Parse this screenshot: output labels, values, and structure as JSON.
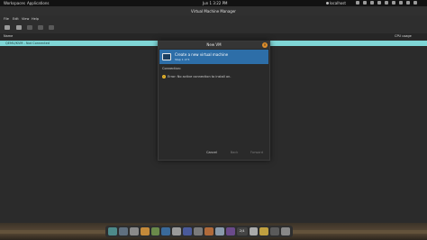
{
  "topbar": {
    "workspaces_label": "Workspaces",
    "applications_label": "Applications",
    "clock": "Jun 1   3:22 PM",
    "hostname": "localhost"
  },
  "window": {
    "title": "Virtual Machine Manager",
    "menu": [
      "File",
      "Edit",
      "View",
      "Help"
    ],
    "column_name": "Name",
    "column_cpu": "CPU usage",
    "connection_row": "QEMU/KVM - Not Connected"
  },
  "dialog": {
    "title": "New VM",
    "close_glyph": "×",
    "banner_title": "Create a new virtual machine",
    "banner_step": "Step 1 of 5",
    "section_label": "Connection:",
    "warn_glyph": "!",
    "error_text": "Error: No active connection to install on.",
    "cancel_label": "Cancel",
    "back_label": "Back",
    "forward_label": "Forward"
  },
  "dock": {
    "workspace_badge": "2/4",
    "apps": [
      {
        "name": "dock-app-1",
        "color": "#4d8a8a"
      },
      {
        "name": "dock-app-2",
        "color": "#5f6f7f"
      },
      {
        "name": "dock-app-3",
        "color": "#8a8a8a"
      },
      {
        "name": "dock-app-4",
        "color": "#c48a3a"
      },
      {
        "name": "dock-app-5",
        "color": "#6a8a4a"
      },
      {
        "name": "dock-app-6",
        "color": "#3a6a9a"
      },
      {
        "name": "dock-app-7",
        "color": "#9a9a9a"
      },
      {
        "name": "dock-app-8",
        "color": "#4a5a9a"
      },
      {
        "name": "dock-app-9",
        "color": "#7a7a7a"
      },
      {
        "name": "dock-app-10",
        "color": "#b06a3a"
      },
      {
        "name": "dock-app-11",
        "color": "#8a9aaa"
      },
      {
        "name": "dock-app-12",
        "color": "#6a4a8a"
      },
      {
        "name": "dock-app-13",
        "color": "#aaaaaa"
      },
      {
        "name": "dock-app-14",
        "color": "#c0a040"
      },
      {
        "name": "dock-app-15",
        "color": "#5a5a5a"
      },
      {
        "name": "dock-app-16",
        "color": "#888888"
      }
    ]
  }
}
